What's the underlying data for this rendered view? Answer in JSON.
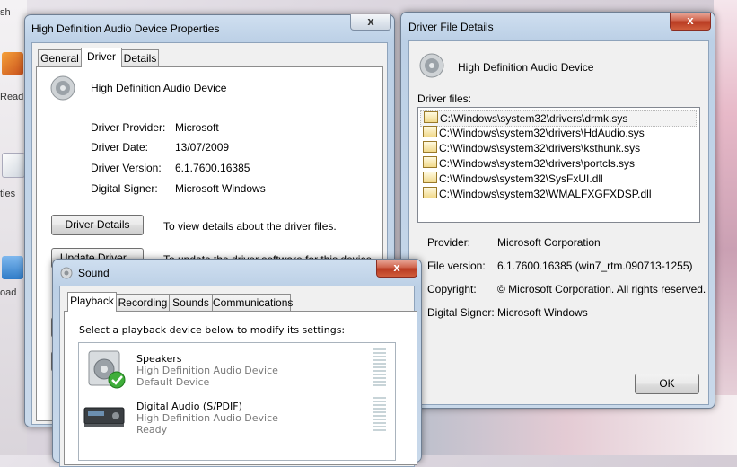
{
  "desktop": {
    "left_labels": [
      "sh",
      "Read",
      "ties",
      "oad"
    ]
  },
  "props": {
    "title": "High Definition Audio Device Properties",
    "tabs": [
      "General",
      "Driver",
      "Details"
    ],
    "device_name": "High Definition Audio Device",
    "rows": [
      {
        "label": "Driver Provider:",
        "value": "Microsoft"
      },
      {
        "label": "Driver Date:",
        "value": "13/07/2009"
      },
      {
        "label": "Driver Version:",
        "value": "6.1.7600.16385"
      },
      {
        "label": "Digital Signer:",
        "value": "Microsoft Windows"
      }
    ],
    "driver_details_btn": "Driver Details",
    "driver_details_desc": "To view details about the driver files.",
    "update_driver_btn": "Update Driver...",
    "update_driver_desc": "To update the driver software for this device."
  },
  "file_details": {
    "title": "Driver File Details",
    "device_name": "High Definition Audio Device",
    "files_label": "Driver files:",
    "files": [
      "C:\\Windows\\system32\\drivers\\drmk.sys",
      "C:\\Windows\\system32\\drivers\\HdAudio.sys",
      "C:\\Windows\\system32\\drivers\\ksthunk.sys",
      "C:\\Windows\\system32\\drivers\\portcls.sys",
      "C:\\Windows\\system32\\SysFxUI.dll",
      "C:\\Windows\\system32\\WMALFXGFXDSP.dll"
    ],
    "info": [
      {
        "label": "Provider:",
        "value": "Microsoft Corporation"
      },
      {
        "label": "File version:",
        "value": "6.1.7600.16385 (win7_rtm.090713-1255)"
      },
      {
        "label": "Copyright:",
        "value": "© Microsoft Corporation. All rights reserved."
      },
      {
        "label": "Digital Signer:",
        "value": "Microsoft Windows"
      }
    ],
    "ok_label": "OK",
    "close_glyph": "x"
  },
  "sound": {
    "title": "Sound",
    "tabs": [
      "Playback",
      "Recording",
      "Sounds",
      "Communications"
    ],
    "instruction": "Select a playback device below to modify its settings:",
    "devices": [
      {
        "name": "Speakers",
        "desc": "High Definition Audio Device",
        "status": "Default Device"
      },
      {
        "name": "Digital Audio (S/PDIF)",
        "desc": "High Definition Audio Device",
        "status": "Ready"
      }
    ],
    "close_glyph": "x"
  },
  "colors": {
    "close_red": "#c8462c",
    "device_desc": "#7a7a7a",
    "sel_border": "#b8b8b8"
  }
}
